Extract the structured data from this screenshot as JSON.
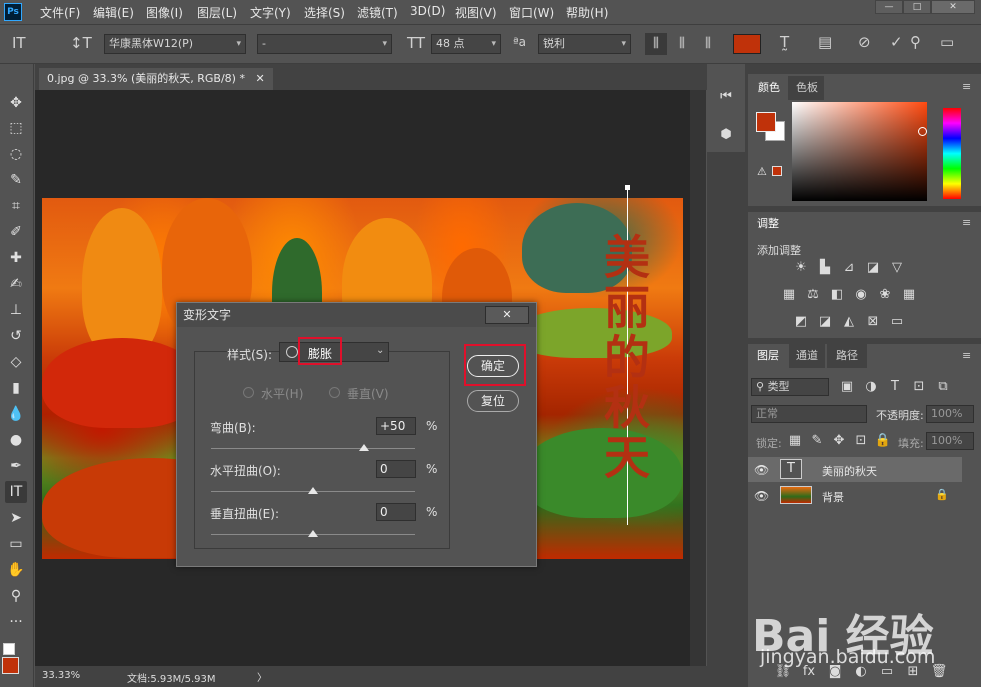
{
  "app": {
    "logo": "Ps"
  },
  "menu": [
    "文件(F)",
    "编辑(E)",
    "图像(I)",
    "图层(L)",
    "文字(Y)",
    "选择(S)",
    "滤镜(T)",
    "3D(D)",
    "视图(V)",
    "窗口(W)",
    "帮助(H)"
  ],
  "window_controls": {
    "minimize": "—",
    "maximize": "□",
    "close": "✕"
  },
  "options": {
    "font_family": "华康黑体W12(P)",
    "font_style": "-",
    "font_size": "48 点",
    "antialias": "锐利",
    "text_color": "#c0320a"
  },
  "document": {
    "tab": "0.jpg @ 33.3% (美丽的秋天, RGB/8) *",
    "tab_close": "✕"
  },
  "canvas_text": "美丽的秋天",
  "status": {
    "zoom": "33.33%",
    "doc": "文档:5.93M/5.93M",
    "arrow": "〉"
  },
  "dialog": {
    "title": "变形文字",
    "close": "✕",
    "style_label": "样式(S):",
    "style_value": "膨胀",
    "horizontal": "水平(H)",
    "vertical": "垂直(V)",
    "bend_label": "弯曲(B):",
    "bend_value": "+50",
    "hdist_label": "水平扭曲(O):",
    "hdist_value": "0",
    "vdist_label": "垂直扭曲(E):",
    "vdist_value": "0",
    "percent": "%",
    "ok": "确定",
    "reset": "复位",
    "bend_pct": 0.75,
    "hdist_pct": 0.5,
    "vdist_pct": 0.5
  },
  "color_panel": {
    "tabs": [
      "颜色",
      "色板"
    ],
    "fg": "#c0320a",
    "bg": "#ffffff",
    "warn_color": "#c0320a"
  },
  "adjust_panel": {
    "tab": "调整",
    "add_label": "添加调整"
  },
  "layers_panel": {
    "tabs": [
      "图层",
      "通道",
      "路径"
    ],
    "filter": "类型",
    "blend": "正常",
    "opacity_label": "不透明度:",
    "opacity": "100%",
    "lock_label": "锁定:",
    "fill_label": "填充:",
    "fill": "100%",
    "layers": [
      {
        "name": "美丽的秋天",
        "thumb": "T"
      },
      {
        "name": "背景"
      }
    ]
  },
  "watermark": {
    "main": "Bai 经验",
    "sub": "jingyan.baidu.com"
  }
}
